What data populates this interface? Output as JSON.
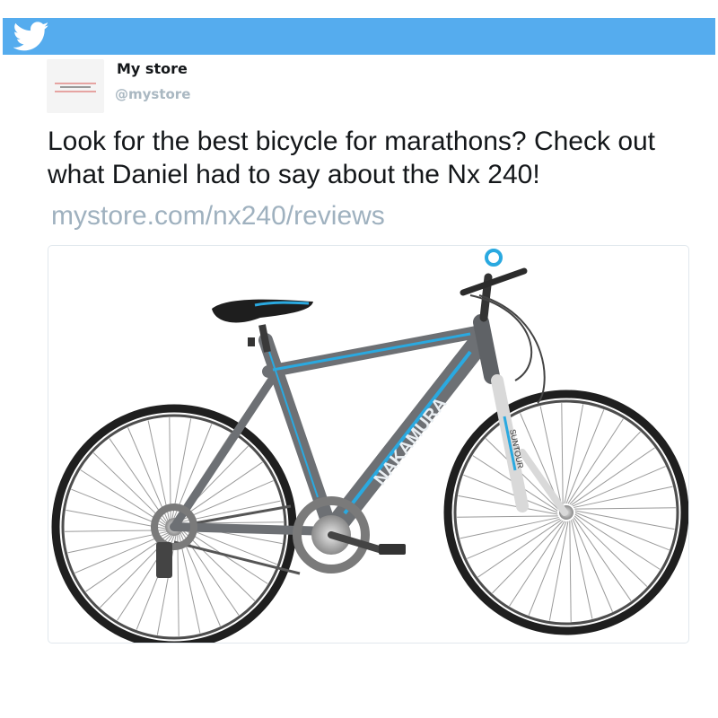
{
  "header": {
    "logo_icon": "twitter-bird-icon",
    "bar_color": "#55acee"
  },
  "tweet": {
    "display_name": "My store",
    "handle": "@mystore",
    "text": "Look for the best bicycle for marathons? Check out what Daniel had to say about the Nx 240!",
    "link": "mystore.com/nx240/reviews",
    "link_color": "#9fb1bf"
  },
  "media": {
    "image_subject": "bicycle",
    "frame_text": "NAKAMURA",
    "fork_text": "SUNTOUR",
    "accent_color": "#2aa9e0",
    "frame_color": "#6d7074"
  }
}
